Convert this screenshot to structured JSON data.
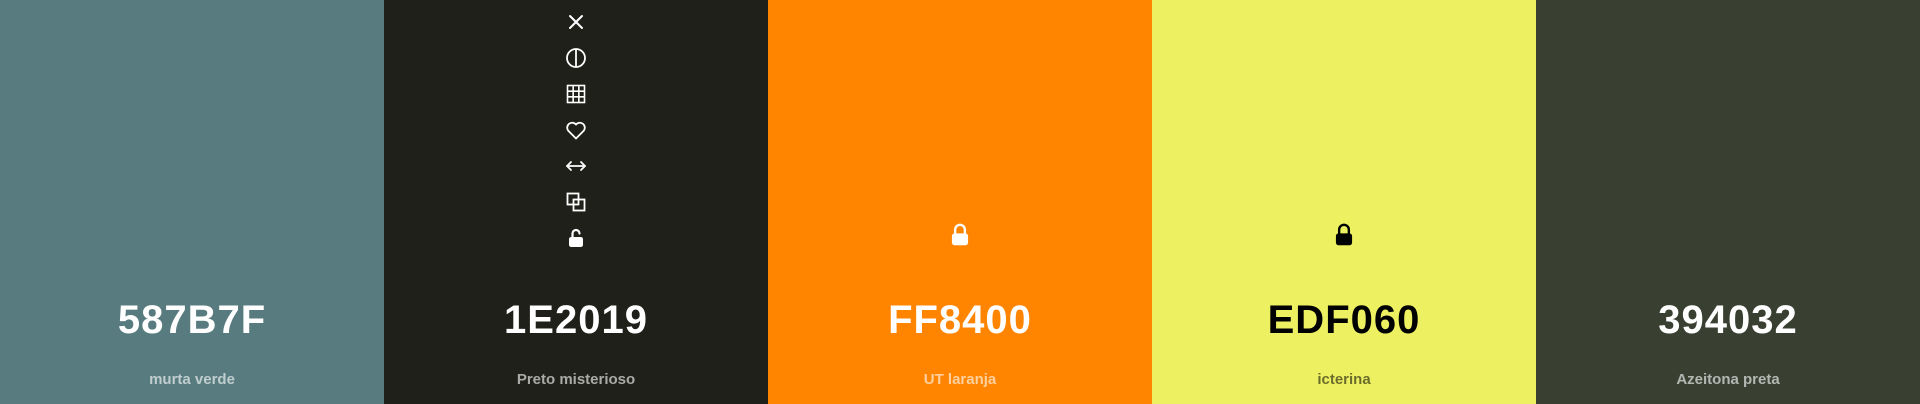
{
  "palette": {
    "swatches": [
      {
        "hex": "587B7F",
        "name": "murta verde",
        "color": "#587B7F",
        "text_tone": "light"
      },
      {
        "hex": "1E2019",
        "name": "Preto misterioso",
        "color": "#1E2019",
        "text_tone": "light"
      },
      {
        "hex": "FF8400",
        "name": "UT laranja",
        "color": "#FF8400",
        "text_tone": "light"
      },
      {
        "hex": "EDF060",
        "name": "icterina",
        "color": "#EDF060",
        "text_tone": "dark"
      },
      {
        "hex": "394032",
        "name": "Azeitona preta",
        "color": "#394032",
        "text_tone": "light"
      }
    ]
  },
  "toolbar": {
    "icons": [
      "close-icon",
      "contrast-icon",
      "grid-icon",
      "heart-icon",
      "arrows-horizontal-icon",
      "copy-icon",
      "unlock-icon"
    ]
  },
  "locks": {
    "locked_icon": "lock-icon",
    "unlocked_icon": "unlock-icon"
  }
}
